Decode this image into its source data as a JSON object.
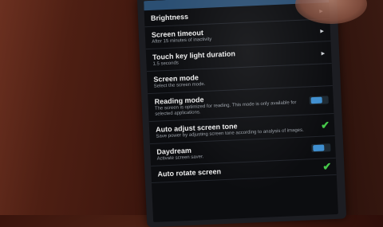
{
  "settings": [
    {
      "title": "Brightness",
      "subtitle": "",
      "control": "chevron"
    },
    {
      "title": "Screen timeout",
      "subtitle": "After 15 minutes of inactivity",
      "control": "chevron"
    },
    {
      "title": "Touch key light duration",
      "subtitle": "1.5 seconds",
      "control": "chevron"
    },
    {
      "title": "Screen mode",
      "subtitle": "Select the screen mode.",
      "control": "none"
    },
    {
      "title": "Reading mode",
      "subtitle": "The screen is optimized for reading. This mode is only available for selected applications.",
      "control": "toggle"
    },
    {
      "title": "Auto adjust screen tone",
      "subtitle": "Save power by adjusting screen tone according to analysis of images.",
      "control": "check"
    },
    {
      "title": "Daydream",
      "subtitle": "Activate screen saver.",
      "control": "toggle"
    },
    {
      "title": "Auto rotate screen",
      "subtitle": "",
      "control": "check"
    }
  ],
  "icons": {
    "chevron": "chevron-right-icon",
    "check": "check-icon",
    "toggle": "toggle-switch"
  },
  "colors": {
    "accent": "#2b4f73",
    "check": "#46c84a",
    "toggle": "#3f8fd0",
    "background": "#0c0d10"
  }
}
